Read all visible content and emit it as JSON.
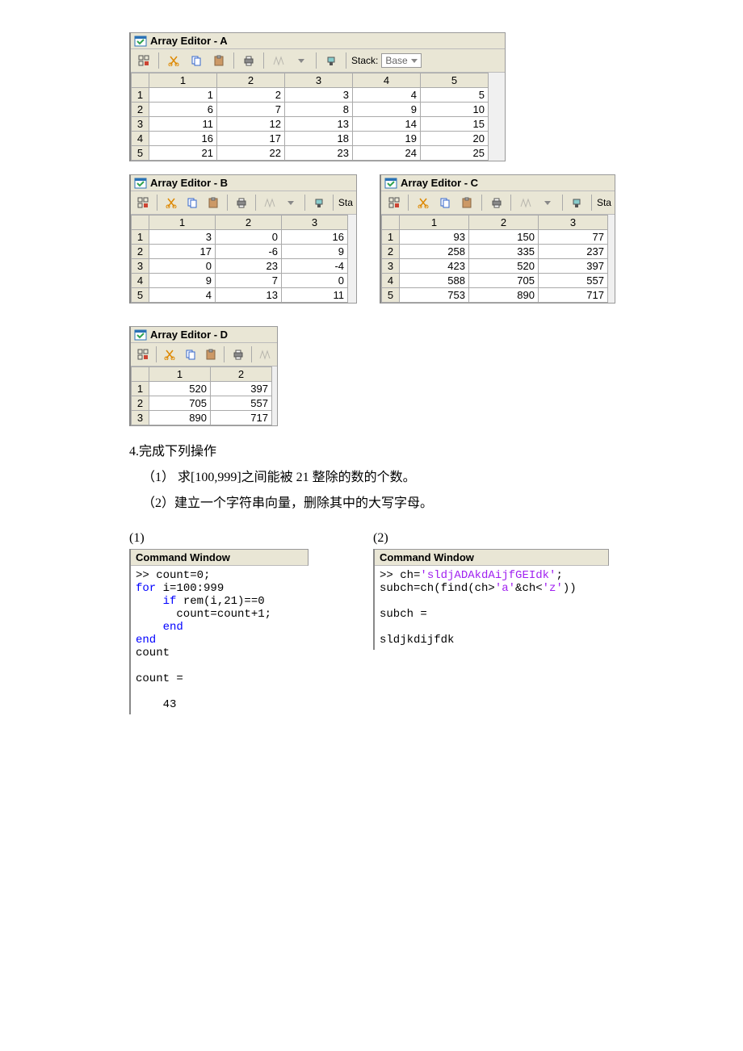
{
  "editor_a": {
    "title": "Array Editor - A",
    "stack_label": "Stack:",
    "stack_value": "Base",
    "cols": [
      "1",
      "2",
      "3",
      "4",
      "5"
    ],
    "rows": [
      "1",
      "2",
      "3",
      "4",
      "5"
    ],
    "cells": [
      [
        "1",
        "2",
        "3",
        "4",
        "5"
      ],
      [
        "6",
        "7",
        "8",
        "9",
        "10"
      ],
      [
        "11",
        "12",
        "13",
        "14",
        "15"
      ],
      [
        "16",
        "17",
        "18",
        "19",
        "20"
      ],
      [
        "21",
        "22",
        "23",
        "24",
        "25"
      ]
    ]
  },
  "editor_b": {
    "title": "Array Editor - B",
    "ste": "Sta",
    "cols": [
      "1",
      "2",
      "3"
    ],
    "rows": [
      "1",
      "2",
      "3",
      "4",
      "5"
    ],
    "cells": [
      [
        "3",
        "0",
        "16"
      ],
      [
        "17",
        "-6",
        "9"
      ],
      [
        "0",
        "23",
        "-4"
      ],
      [
        "9",
        "7",
        "0"
      ],
      [
        "4",
        "13",
        "11"
      ]
    ]
  },
  "editor_c": {
    "title": "Array Editor - C",
    "ste": "Sta",
    "cols": [
      "1",
      "2",
      "3"
    ],
    "rows": [
      "1",
      "2",
      "3",
      "4",
      "5"
    ],
    "cells": [
      [
        "93",
        "150",
        "77"
      ],
      [
        "258",
        "335",
        "237"
      ],
      [
        "423",
        "520",
        "397"
      ],
      [
        "588",
        "705",
        "557"
      ],
      [
        "753",
        "890",
        "717"
      ]
    ]
  },
  "editor_d": {
    "title": "Array Editor - D",
    "cols": [
      "1",
      "2"
    ],
    "rows": [
      "1",
      "2",
      "3"
    ],
    "cells": [
      [
        "520",
        "397"
      ],
      [
        "705",
        "557"
      ],
      [
        "890",
        "717"
      ]
    ]
  },
  "exercise": {
    "heading": "4.完成下列操作",
    "item1": "（1） 求[100,999]之间能被 21 整除的数的个数。",
    "item2": "（2）建立一个字符串向量，删除其中的大写字母。"
  },
  "cmd": {
    "label1": "(1)",
    "label2": "(2)",
    "title": "Command Window",
    "code1": {
      "l1a": ">> count=0;",
      "l2a": "for",
      "l2b": " i=100:999",
      "l3a": "    if",
      "l3b": " rem(i,21)==0",
      "l4": "      count=count+1;",
      "l5": "    end",
      "l6": "end",
      "l7": "count",
      "l8": "",
      "l9": "count =",
      "l10": "",
      "l11": "    43"
    },
    "code2": {
      "l1a": ">> ch=",
      "l1b": "'sldjADAkdAijfGEIdk'",
      "l1c": ";",
      "l2a": "subch=ch(find(ch>",
      "l2b": "'a'",
      "l2c": "&ch<",
      "l2d": "'z'",
      "l2e": "))",
      "l3": "",
      "l4": "subch =",
      "l5": "",
      "l6": "sldjkdijfdk"
    }
  }
}
